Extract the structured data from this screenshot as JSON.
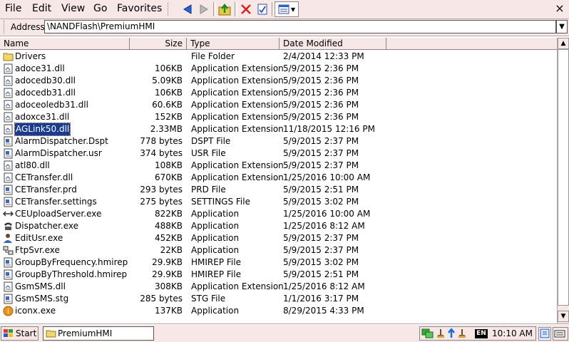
{
  "menu": {
    "file": "File",
    "edit": "Edit",
    "view": "View",
    "go": "Go",
    "favorites": "Favorites"
  },
  "toolbar": {
    "close_glyph": "×",
    "buttons": [
      "back-icon",
      "forward-icon",
      "up-folder-icon",
      "delete-icon",
      "properties-icon",
      "views-icon"
    ]
  },
  "address": {
    "label": "Address",
    "value": "\\NANDFlash\\PremiumHMI"
  },
  "columns": {
    "name": "Name",
    "size": "Size",
    "type": "Type",
    "date": "Date Modified"
  },
  "files": [
    {
      "name": "Drivers",
      "size": "",
      "type": "File Folder",
      "date": "2/4/2014 12:33 PM",
      "icon": "folder-icon"
    },
    {
      "name": "adoce31.dll",
      "size": "106KB",
      "type": "Application Extension",
      "date": "5/9/2015 2:36 PM",
      "icon": "dll-icon"
    },
    {
      "name": "adocedb30.dll",
      "size": "5.09KB",
      "type": "Application Extension",
      "date": "5/9/2015 2:36 PM",
      "icon": "dll-icon"
    },
    {
      "name": "adocedb31.dll",
      "size": "106KB",
      "type": "Application Extension",
      "date": "5/9/2015 2:36 PM",
      "icon": "dll-icon"
    },
    {
      "name": "adoceoledb31.dll",
      "size": "60.6KB",
      "type": "Application Extension",
      "date": "5/9/2015 2:36 PM",
      "icon": "dll-icon"
    },
    {
      "name": "adoxce31.dll",
      "size": "152KB",
      "type": "Application Extension",
      "date": "5/9/2015 2:36 PM",
      "icon": "dll-icon"
    },
    {
      "name": "AGLink50.dll",
      "size": "2.33MB",
      "type": "Application Extension",
      "date": "11/18/2015 12:16 PM",
      "icon": "dll-icon",
      "selected": true
    },
    {
      "name": "AlarmDispatcher.Dspt",
      "size": "778 bytes",
      "type": "DSPT File",
      "date": "5/9/2015 2:37 PM",
      "icon": "file-icon"
    },
    {
      "name": "AlarmDispatcher.usr",
      "size": "374 bytes",
      "type": "USR File",
      "date": "5/9/2015 2:37 PM",
      "icon": "file-icon"
    },
    {
      "name": "atl80.dll",
      "size": "108KB",
      "type": "Application Extension",
      "date": "5/9/2015 2:37 PM",
      "icon": "dll-icon"
    },
    {
      "name": "CETransfer.dll",
      "size": "670KB",
      "type": "Application Extension",
      "date": "1/25/2016 10:00 AM",
      "icon": "dll-icon"
    },
    {
      "name": "CETransfer.prd",
      "size": "293 bytes",
      "type": "PRD File",
      "date": "5/9/2015 2:51 PM",
      "icon": "file-icon"
    },
    {
      "name": "CETransfer.settings",
      "size": "275 bytes",
      "type": "SETTINGS File",
      "date": "5/9/2015 3:02 PM",
      "icon": "file-icon"
    },
    {
      "name": "CEUploadServer.exe",
      "size": "822KB",
      "type": "Application",
      "date": "1/25/2016 10:00 AM",
      "icon": "upload-exe-icon"
    },
    {
      "name": "Dispatcher.exe",
      "size": "488KB",
      "type": "Application",
      "date": "1/25/2016 8:12 AM",
      "icon": "phone-exe-icon"
    },
    {
      "name": "EditUsr.exe",
      "size": "452KB",
      "type": "Application",
      "date": "5/9/2015 2:37 PM",
      "icon": "user-exe-icon"
    },
    {
      "name": "FtpSvr.exe",
      "size": "22KB",
      "type": "Application",
      "date": "5/9/2015 2:37 PM",
      "icon": "network-exe-icon"
    },
    {
      "name": "GroupByFrequency.hmirep",
      "size": "29.9KB",
      "type": "HMIREP File",
      "date": "5/9/2015 3:02 PM",
      "icon": "file-icon"
    },
    {
      "name": "GroupByThreshold.hmirep",
      "size": "29.9KB",
      "type": "HMIREP File",
      "date": "5/9/2015 2:51 PM",
      "icon": "file-icon"
    },
    {
      "name": "GsmSMS.dll",
      "size": "308KB",
      "type": "Application Extension",
      "date": "1/25/2016 8:12 AM",
      "icon": "dll-icon"
    },
    {
      "name": "GsmSMS.stg",
      "size": "285 bytes",
      "type": "STG File",
      "date": "1/1/2016 3:17 PM",
      "icon": "file-icon"
    },
    {
      "name": "iconx.exe",
      "size": "137KB",
      "type": "Application",
      "date": "8/29/2015 4:33 PM",
      "icon": "iconx-exe-icon"
    }
  ],
  "taskbar": {
    "start": "Start",
    "task": "PremiumHMI",
    "lang": "EN",
    "clock": "10:10 AM"
  }
}
